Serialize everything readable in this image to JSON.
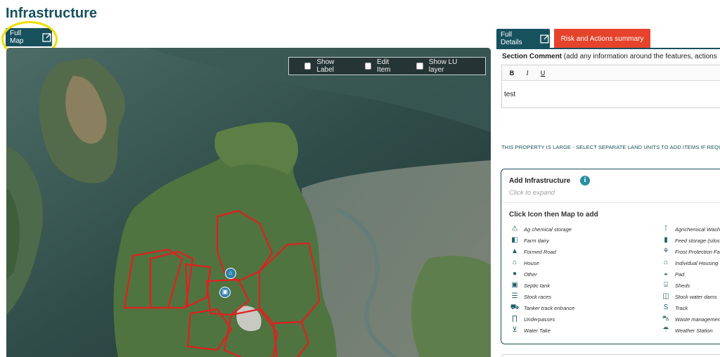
{
  "page": {
    "title": "Infrastructure"
  },
  "full_map": {
    "label": "Full Map",
    "icon": "external-link-icon"
  },
  "map": {
    "controls": [
      {
        "label": "Show Label",
        "checked": false
      },
      {
        "label": "Edit Item",
        "checked": false
      },
      {
        "label": "Show LU layer",
        "checked": false
      }
    ],
    "markers": [
      "house-marker-icon",
      "septic-tank-marker-icon"
    ]
  },
  "tabs": {
    "full_details": "Full Details",
    "risk": "Risk and Actions summary"
  },
  "comment": {
    "label": "Section Comment",
    "hint": "(add any information around the features, actions",
    "toolbar": [
      "B",
      "I",
      "U"
    ],
    "value": "test"
  },
  "notice": "THIS PROPERTY IS LARGE - SELECT SEPARATE LAND UNITS TO ADD ITEMS IF REQUIR",
  "add_infrastructure": {
    "title": "Add Infrastructure",
    "expand_hint": "Click to expand",
    "instruction": "Click Icon then Map to add",
    "left_items": [
      {
        "label": "Ag chemical storage",
        "icon": "⚠"
      },
      {
        "label": "Farm dairy",
        "icon": "◧"
      },
      {
        "label": "Formed Road",
        "icon": "▲"
      },
      {
        "label": "House",
        "icon": "⌂"
      },
      {
        "label": "Other",
        "icon": "●"
      },
      {
        "label": "Septic tank",
        "icon": "▣"
      },
      {
        "label": "Stock races",
        "icon": "☰"
      },
      {
        "label": "Tanker track entrance",
        "icon": "⛟"
      },
      {
        "label": "Underpasses",
        "icon": "∏"
      },
      {
        "label": "Water Take",
        "icon": "⊻"
      }
    ],
    "right_items": [
      {
        "label": "Agrichemical Wash",
        "icon": "⊺"
      },
      {
        "label": "Feed storage (silos,",
        "icon": "▮"
      },
      {
        "label": "Frost Protection Fa",
        "icon": "⚘"
      },
      {
        "label": "Individual Housing",
        "icon": "⌂"
      },
      {
        "label": "Pad",
        "icon": "◒"
      },
      {
        "label": "Sheds",
        "icon": "⌸"
      },
      {
        "label": "Stock water dams",
        "icon": "◫"
      },
      {
        "label": "Track",
        "icon": "S"
      },
      {
        "label": "Waste managemen",
        "icon": "⛍"
      },
      {
        "label": "Weather Station",
        "icon": "☂"
      }
    ]
  },
  "colors": {
    "brand": "#17515e",
    "risk_tab": "#e5432b",
    "highlight": "#f2dd00",
    "boundary": "#e02020"
  }
}
